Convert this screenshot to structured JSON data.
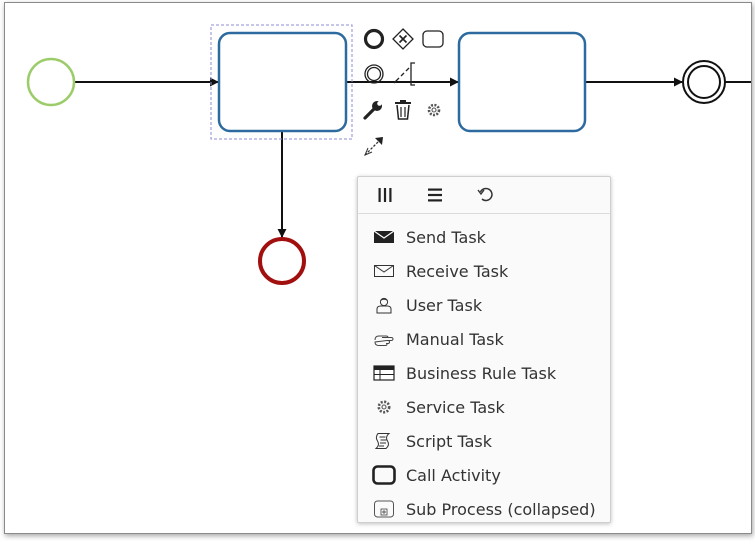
{
  "diagram": {
    "colors": {
      "start_event": "#9ccc6a",
      "task_stroke": "#2c6aa0",
      "end_event_red": "#a10f0f",
      "selection": "#8d8dd6",
      "stroke": "#111111"
    },
    "elements": [
      {
        "id": "start-event",
        "type": "start-event",
        "label": ""
      },
      {
        "id": "task-1",
        "type": "task",
        "label": "",
        "selected": true
      },
      {
        "id": "task-2",
        "type": "task",
        "label": ""
      },
      {
        "id": "end-event-main",
        "type": "end-event",
        "label": ""
      },
      {
        "id": "end-event-error",
        "type": "end-event",
        "label": ""
      }
    ],
    "connections": [
      {
        "from": "start-event",
        "to": "task-1"
      },
      {
        "from": "task-1",
        "to": "task-2"
      },
      {
        "from": "task-2",
        "to": "end-event-main"
      },
      {
        "from": "task-1",
        "to": "end-event-error"
      }
    ]
  },
  "context_pad": {
    "items": [
      {
        "name": "append-end-event-icon"
      },
      {
        "name": "append-gateway-icon"
      },
      {
        "name": "append-task-icon"
      },
      {
        "name": "append-intermediate-event-icon"
      },
      {
        "name": "text-annotation-icon"
      },
      {
        "name": "change-type-wrench-icon"
      },
      {
        "name": "delete-trash-icon"
      },
      {
        "name": "color-gear-icon"
      },
      {
        "name": "connect-arrow-icon"
      }
    ]
  },
  "replace_menu": {
    "header_icons": [
      "parallel-multi-instance-icon",
      "sequential-multi-instance-icon",
      "loop-icon"
    ],
    "entries": [
      {
        "label": "Send Task",
        "icon": "send-task-icon"
      },
      {
        "label": "Receive Task",
        "icon": "receive-task-icon"
      },
      {
        "label": "User Task",
        "icon": "user-task-icon"
      },
      {
        "label": "Manual Task",
        "icon": "manual-task-icon"
      },
      {
        "label": "Business Rule Task",
        "icon": "business-rule-task-icon"
      },
      {
        "label": "Service Task",
        "icon": "service-task-icon"
      },
      {
        "label": "Script Task",
        "icon": "script-task-icon"
      },
      {
        "label": "Call Activity",
        "icon": "call-activity-icon"
      },
      {
        "label": "Sub Process (collapsed)",
        "icon": "sub-process-collapsed-icon"
      }
    ]
  }
}
